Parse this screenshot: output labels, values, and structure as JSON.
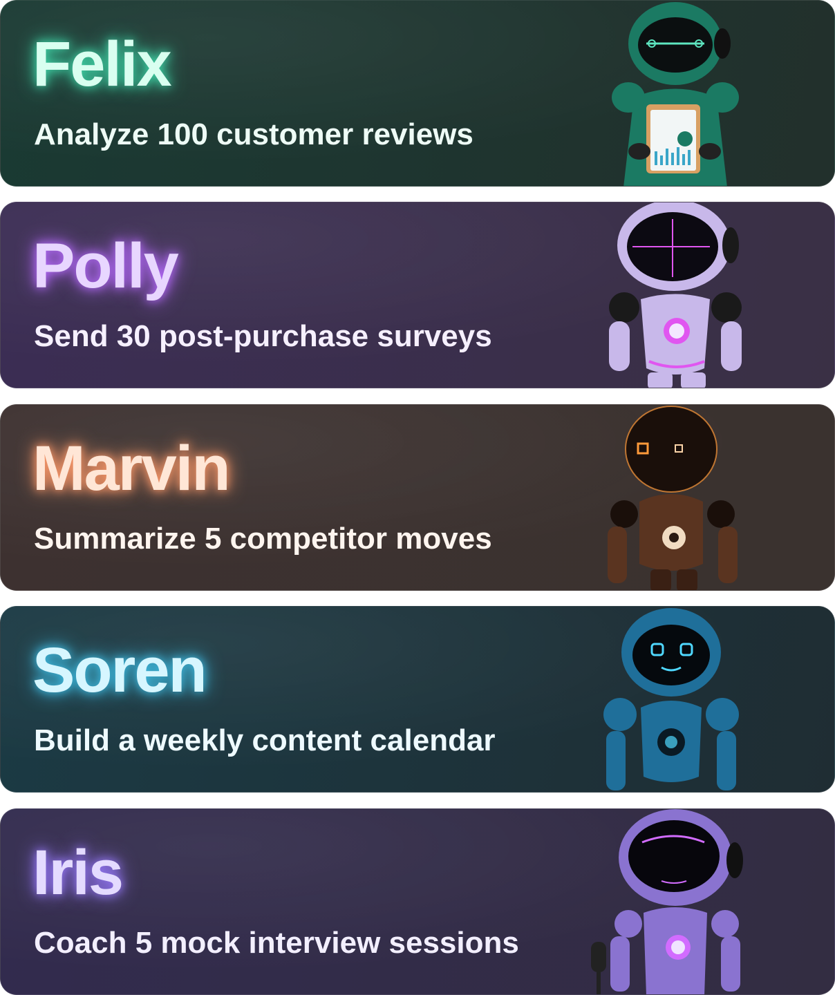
{
  "agents": [
    {
      "name": "Felix",
      "task": "Analyze 100 customer reviews",
      "colors": {
        "bg_left": "#1a3a33",
        "bg_right": "#22302c",
        "name": "#d9fff0",
        "glow": "#3fd6a8",
        "task": "#eefcf6",
        "robot_body": "#1b7a63",
        "robot_accent": "#5ee6c0"
      },
      "icons": [
        "robot-with-clipboard-icon"
      ]
    },
    {
      "name": "Polly",
      "task": "Send 30 post-purchase surveys",
      "colors": {
        "bg_left": "#3b2d54",
        "bg_right": "#3a3045",
        "name": "#e8d6ff",
        "glow": "#b86bff",
        "task": "#f6f0ff",
        "robot_body": "#c8b8ea",
        "robot_accent": "#e056f0"
      },
      "icons": [
        "robot-icon"
      ]
    },
    {
      "name": "Marvin",
      "task": "Summarize 5 competitor moves",
      "colors": {
        "bg_left": "#3d3130",
        "bg_right": "#3a322f",
        "name": "#ffe6d6",
        "glow": "#ff9a6a",
        "task": "#fff5ef",
        "robot_body": "#5a3420",
        "robot_accent": "#ff9a3a"
      },
      "icons": [
        "robot-icon"
      ]
    },
    {
      "name": "Soren",
      "task": "Build a weekly content calendar",
      "colors": {
        "bg_left": "#1b3a44",
        "bg_right": "#1f2d33",
        "name": "#d6f6ff",
        "glow": "#3fc0e8",
        "task": "#eefaff",
        "robot_body": "#1f6f9a",
        "robot_accent": "#4fd8ff"
      },
      "icons": [
        "robot-icon"
      ]
    },
    {
      "name": "Iris",
      "task": "Coach 5 mock interview sessions",
      "colors": {
        "bg_left": "#322b4e",
        "bg_right": "#332d42",
        "name": "#e4dbff",
        "glow": "#9a7bff",
        "task": "#f3efff",
        "robot_body": "#8a73d0",
        "robot_accent": "#d26cff"
      },
      "icons": [
        "robot-with-microphone-icon"
      ]
    }
  ]
}
